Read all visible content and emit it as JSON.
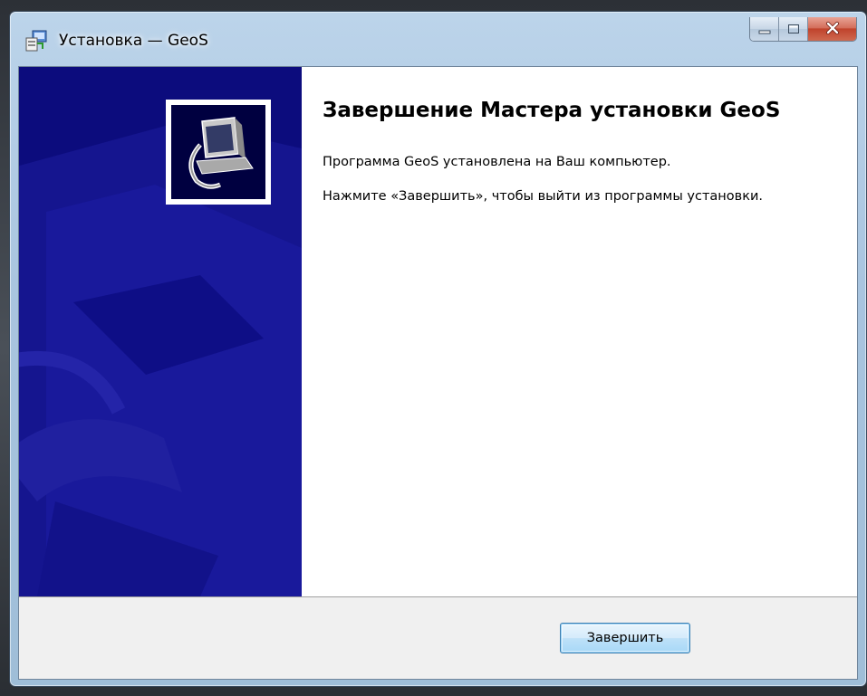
{
  "window": {
    "title": "Установка — GeoS",
    "controls": {
      "minimize": "minimize-icon",
      "maximize": "maximize-icon",
      "close": "close-icon"
    }
  },
  "banner": {
    "icon": "setup-computer-icon",
    "background_color": "#0c0c7d"
  },
  "content": {
    "heading": "Завершение Мастера установки GeoS",
    "installed_text": "Программа GeoS установлена на Ваш компьютер.",
    "finish_hint": "Нажмите «Завершить», чтобы выйти из программы установки."
  },
  "footer": {
    "finish_label": "Завершить"
  },
  "colors": {
    "accent": "#3c7fb1",
    "close_button": "#c0432c"
  }
}
